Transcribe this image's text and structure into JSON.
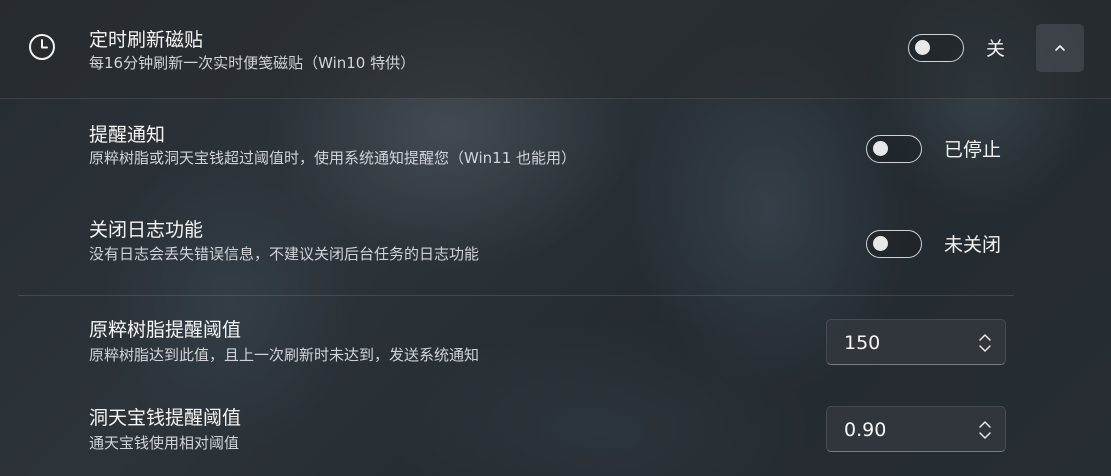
{
  "header": {
    "title": "定时刷新磁贴",
    "description": "每16分钟刷新一次实时便笺磁贴（Win10 特供）",
    "toggle_state": "关",
    "icon": "clock-icon",
    "collapse_icon": "chevron-up-icon"
  },
  "settings": [
    {
      "title": "提醒通知",
      "description": "原粹树脂或洞天宝钱超过阈值时，使用系统通知提醒您（Win11 也能用）",
      "toggle_state": "已停止"
    },
    {
      "title": "关闭日志功能",
      "description": "没有日志会丢失错误信息，不建议关闭后台任务的日志功能",
      "toggle_state": "未关闭"
    }
  ],
  "thresholds": [
    {
      "title": "原粹树脂提醒阈值",
      "description": "原粹树脂达到此值，且上一次刷新时未达到，发送系统通知",
      "value": "150"
    },
    {
      "title": "洞天宝钱提醒阈值",
      "description": "通天宝钱使用相对阈值",
      "value": "0.90"
    }
  ],
  "colors": {
    "text": "#f5f5f5",
    "secondary_text": "#d0d4d8",
    "toggle_border": "#cfd3d6"
  }
}
